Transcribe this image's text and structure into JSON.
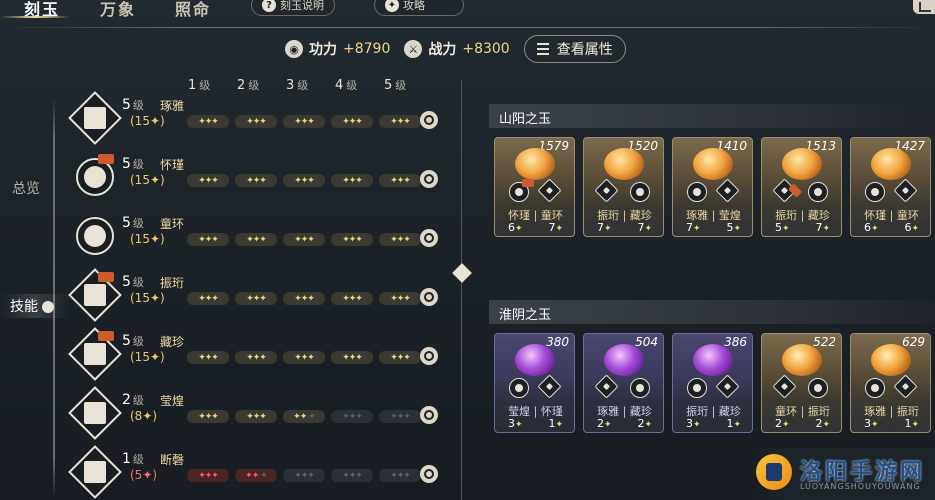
{
  "tabs": [
    {
      "label": "刻玉"
    },
    {
      "label": "万象"
    },
    {
      "label": "照命"
    }
  ],
  "help_button": {
    "icon": "?",
    "label": "刻玉说明"
  },
  "guide_button": {
    "label": "攻略"
  },
  "stats": {
    "power_label": "功力",
    "power_value": "+8790",
    "combat_label": "战力",
    "combat_value": "+8300",
    "view_button": "查看属性"
  },
  "side_nav": [
    {
      "label": "总览"
    },
    {
      "label": "技能"
    }
  ],
  "level_headers": [
    {
      "num": "1",
      "unit": "级"
    },
    {
      "num": "2",
      "unit": "级"
    },
    {
      "num": "3",
      "unit": "级"
    },
    {
      "num": "4",
      "unit": "级"
    },
    {
      "num": "5",
      "unit": "级"
    }
  ],
  "skills": [
    {
      "level": "5",
      "unit": "级",
      "name": "琢雅",
      "count": "(15✦)",
      "stars": [
        3,
        3,
        3,
        3,
        3
      ]
    },
    {
      "level": "5",
      "unit": "级",
      "name": "怀瑾",
      "count": "(15✦)",
      "stars": [
        3,
        3,
        3,
        3,
        3
      ]
    },
    {
      "level": "5",
      "unit": "级",
      "name": "童环",
      "count": "(15✦)",
      "stars": [
        3,
        3,
        3,
        3,
        3
      ]
    },
    {
      "level": "5",
      "unit": "级",
      "name": "振珩",
      "count": "(15✦)",
      "stars": [
        3,
        3,
        3,
        3,
        3
      ]
    },
    {
      "level": "5",
      "unit": "级",
      "name": "藏珍",
      "count": "(15✦)",
      "stars": [
        3,
        3,
        3,
        3,
        3
      ]
    },
    {
      "level": "2",
      "unit": "级",
      "name": "莹煌",
      "count": "(8✦)",
      "stars": [
        3,
        3,
        2,
        0,
        0
      ]
    },
    {
      "level": "1",
      "unit": "级",
      "name": "断磬",
      "count": "(5✦)",
      "stars": [
        3,
        2,
        0,
        0,
        0
      ]
    }
  ],
  "sections": [
    {
      "title": "山阳之玉",
      "cards": [
        {
          "value": "1579",
          "names": "怀瑾 | 童环",
          "v1": "6",
          "v2": "7"
        },
        {
          "value": "1520",
          "names": "振珩 | 藏珍",
          "v1": "7",
          "v2": "7"
        },
        {
          "value": "1410",
          "names": "琢雅 | 莹煌",
          "v1": "7",
          "v2": "5"
        },
        {
          "value": "1513",
          "names": "振珩 | 藏珍",
          "v1": "5",
          "v2": "7"
        },
        {
          "value": "1427",
          "names": "怀瑾 | 童环",
          "v1": "6",
          "v2": "6"
        }
      ]
    },
    {
      "title": "淮阴之玉",
      "cards": [
        {
          "value": "380",
          "names": "莹煌 | 怀瑾",
          "v1": "3",
          "v2": "1"
        },
        {
          "value": "504",
          "names": "琢雅 | 藏珍",
          "v1": "2",
          "v2": "2"
        },
        {
          "value": "386",
          "names": "振珩 | 藏珍",
          "v1": "3",
          "v2": "1"
        },
        {
          "value": "522",
          "names": "童环 | 振珩",
          "v1": "2",
          "v2": "2"
        },
        {
          "value": "629",
          "names": "琢雅 | 振珩",
          "v1": "3",
          "v2": "1"
        }
      ]
    }
  ],
  "watermark": {
    "text": "洛阳手游网",
    "sub": "LUOYANGSHOUYOUWANG"
  }
}
